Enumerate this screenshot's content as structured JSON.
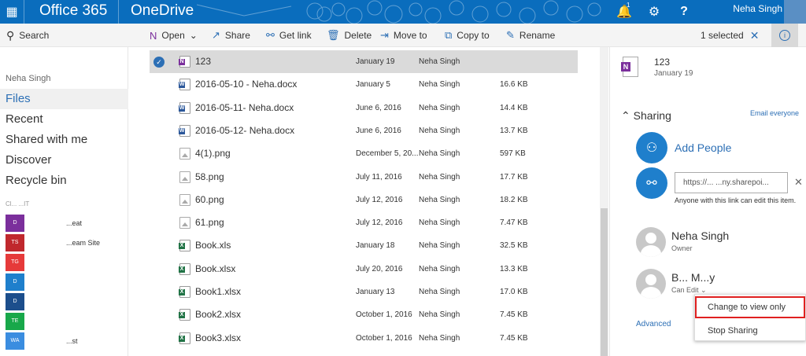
{
  "topbar": {
    "suite": "Office 365",
    "app": "OneDrive",
    "notification_count": "1",
    "user": "Neha Singh",
    "icons": [
      "waffle-icon",
      "bell-icon",
      "gear-icon",
      "help-icon"
    ]
  },
  "commands": {
    "search": "Search",
    "open": "Open",
    "share": "Share",
    "getlink": "Get link",
    "delete": "Delete",
    "moveto": "Move to",
    "copyto": "Copy to",
    "rename": "Rename",
    "selected": "1 selected"
  },
  "sidebar": {
    "owner": "Neha Singh",
    "items": [
      {
        "label": "Files",
        "active": true
      },
      {
        "label": "Recent",
        "active": false
      },
      {
        "label": "Shared with me",
        "active": false
      },
      {
        "label": "Discover",
        "active": false
      },
      {
        "label": "Recycle bin",
        "active": false
      }
    ],
    "groups_heading": "Cl... ...IT",
    "groups": [
      {
        "abbr": "D",
        "label": "...eat",
        "color": "#7b2f9c"
      },
      {
        "abbr": "TS",
        "label": "...eam Site",
        "color": "#c0282d"
      },
      {
        "abbr": "TG",
        "label": "",
        "color": "#e63a3a"
      },
      {
        "abbr": "D",
        "label": "",
        "color": "#1f7fcc"
      },
      {
        "abbr": "D",
        "label": "",
        "color": "#1c4e8c"
      },
      {
        "abbr": "TE",
        "label": "",
        "color": "#18a84a"
      },
      {
        "abbr": "WA",
        "label": "...st",
        "color": "#3a8de0"
      }
    ]
  },
  "files": [
    {
      "name": "123",
      "date": "January 19",
      "by": "Neha Singh",
      "size": "",
      "type": "onenote",
      "selected": true
    },
    {
      "name": "2016-05-10 - Neha.docx",
      "date": "January 5",
      "by": "Neha Singh",
      "size": "16.6 KB",
      "type": "word",
      "selected": false
    },
    {
      "name": "2016-05-11- Neha.docx",
      "date": "June 6, 2016",
      "by": "Neha Singh",
      "size": "14.4 KB",
      "type": "word",
      "selected": false
    },
    {
      "name": "2016-05-12- Neha.docx",
      "date": "June 6, 2016",
      "by": "Neha Singh",
      "size": "13.7 KB",
      "type": "word",
      "selected": false
    },
    {
      "name": "4(1).png",
      "date": "December 5, 20...",
      "by": "Neha Singh",
      "size": "597 KB",
      "type": "image",
      "selected": false
    },
    {
      "name": "58.png",
      "date": "July 11, 2016",
      "by": "Neha Singh",
      "size": "17.7 KB",
      "type": "image",
      "selected": false
    },
    {
      "name": "60.png",
      "date": "July 12, 2016",
      "by": "Neha Singh",
      "size": "18.2 KB",
      "type": "image",
      "selected": false
    },
    {
      "name": "61.png",
      "date": "July 12, 2016",
      "by": "Neha Singh",
      "size": "7.47 KB",
      "type": "image",
      "selected": false
    },
    {
      "name": "Book.xls",
      "date": "January 18",
      "by": "Neha Singh",
      "size": "32.5 KB",
      "type": "excel",
      "selected": false
    },
    {
      "name": "Book.xlsx",
      "date": "July 20, 2016",
      "by": "Neha Singh",
      "size": "13.3 KB",
      "type": "excel",
      "selected": false
    },
    {
      "name": "Book1.xlsx",
      "date": "January 13",
      "by": "Neha Singh",
      "size": "17.0 KB",
      "type": "excel",
      "selected": false
    },
    {
      "name": "Book2.xlsx",
      "date": "October 1, 2016",
      "by": "Neha Singh",
      "size": "7.45 KB",
      "type": "excel",
      "selected": false
    },
    {
      "name": "Book3.xlsx",
      "date": "October 1, 2016",
      "by": "Neha Singh",
      "size": "7.45 KB",
      "type": "excel",
      "selected": false
    }
  ],
  "details": {
    "name": "123",
    "date": "January 19",
    "sharing": "Sharing",
    "email_everyone": "Email everyone",
    "add_people": "Add People",
    "link": "https://... ...ny.sharepoi...",
    "link_desc": "Anyone with this link can edit this item.",
    "people": [
      {
        "name": "Neha Singh",
        "role": "Owner"
      },
      {
        "name": "B... M...y",
        "role": "Can Edit"
      }
    ],
    "advanced": "Advanced"
  },
  "context_menu": {
    "items": [
      "Change to view only",
      "Stop Sharing"
    ]
  },
  "colors": {
    "brand": "#0a6dbd",
    "accent": "#2c6fb5",
    "highlight": "#e02020"
  }
}
